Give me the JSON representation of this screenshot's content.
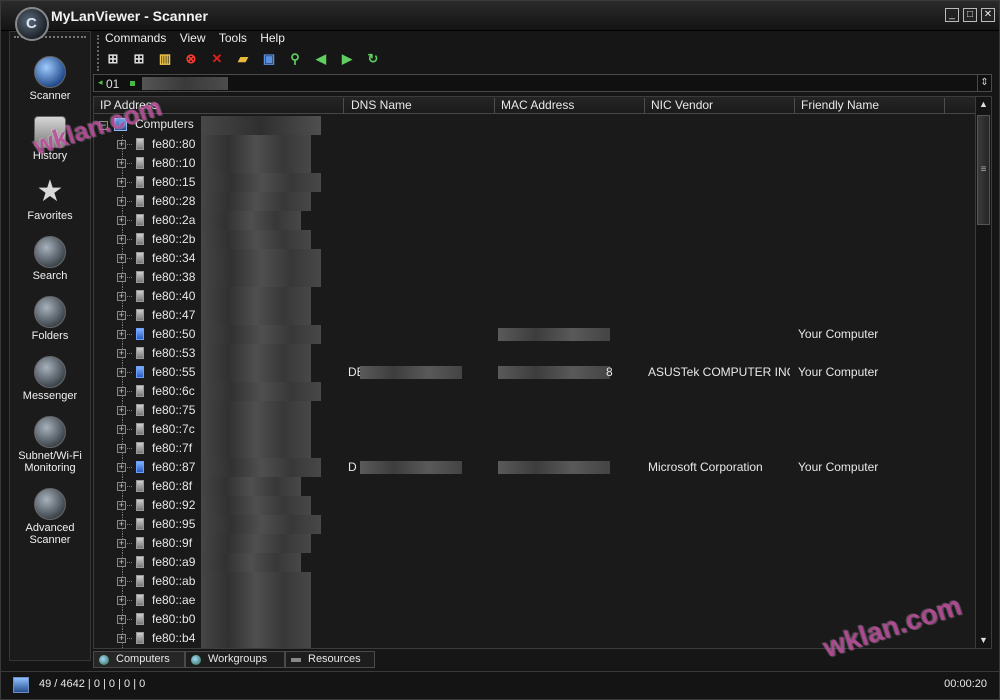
{
  "window": {
    "title": "MyLanViewer - Scanner",
    "logo_glyph": "C"
  },
  "menu": [
    "Commands",
    "View",
    "Tools",
    "Help"
  ],
  "sidebar": {
    "items": [
      {
        "label": "Scanner",
        "icon": "globe-icon"
      },
      {
        "label": "History",
        "icon": "history-icon"
      },
      {
        "label": "Favorites",
        "icon": "star-icon"
      },
      {
        "label": "Search",
        "icon": "search-icon"
      },
      {
        "label": "Folders",
        "icon": "folders-icon"
      },
      {
        "label": "Messenger",
        "icon": "messenger-icon"
      },
      {
        "label": "Subnet/Wi-Fi Monitoring",
        "icon": "monitoring-icon"
      },
      {
        "label": "Advanced Scanner",
        "icon": "advanced-scanner-icon"
      }
    ]
  },
  "address": {
    "value": "01"
  },
  "columns": [
    "IP Address",
    "DNS Name",
    "MAC Address",
    "NIC Vendor",
    "Friendly Name"
  ],
  "tree_root": {
    "label": "Computers"
  },
  "rows": [
    {
      "ip": "fe80::80",
      "dns": "",
      "mac": "",
      "vendor": "",
      "friendly": ""
    },
    {
      "ip": "fe80::10",
      "dns": "",
      "mac": "",
      "vendor": "",
      "friendly": ""
    },
    {
      "ip": "fe80::15",
      "dns": "",
      "mac": "",
      "vendor": "",
      "friendly": ""
    },
    {
      "ip": "fe80::28",
      "dns": "",
      "mac": "",
      "vendor": "",
      "friendly": ""
    },
    {
      "ip": "fe80::2a",
      "dns": "",
      "mac": "",
      "vendor": "",
      "friendly": ""
    },
    {
      "ip": "fe80::2b",
      "dns": "",
      "mac": "",
      "vendor": "",
      "friendly": ""
    },
    {
      "ip": "fe80::34",
      "dns": "",
      "mac": "",
      "vendor": "",
      "friendly": ""
    },
    {
      "ip": "fe80::38",
      "dns": "",
      "mac": "",
      "vendor": "",
      "friendly": ""
    },
    {
      "ip": "fe80::40",
      "dns": "",
      "mac": "",
      "vendor": "",
      "friendly": ""
    },
    {
      "ip": "fe80::47",
      "dns": "",
      "mac": "",
      "vendor": "",
      "friendly": ""
    },
    {
      "ip": "fe80::50",
      "dns": "",
      "mac": "",
      "vendor": "",
      "friendly": "Your Computer",
      "own": true,
      "mac_blur": true
    },
    {
      "ip": "fe80::53",
      "dns": "",
      "mac": "",
      "vendor": "",
      "friendly": ""
    },
    {
      "ip": "fe80::55",
      "dns": "DE",
      "mac": "8",
      "vendor": "ASUSTek COMPUTER INC",
      "friendly": "Your Computer",
      "own": true,
      "dns_blur": true,
      "mac_blur": true
    },
    {
      "ip": "fe80::6c",
      "dns": "",
      "mac": "",
      "vendor": "",
      "friendly": ""
    },
    {
      "ip": "fe80::75",
      "dns": "",
      "mac": "",
      "vendor": "",
      "friendly": ""
    },
    {
      "ip": "fe80::7c",
      "dns": "",
      "mac": "",
      "vendor": "",
      "friendly": ""
    },
    {
      "ip": "fe80::7f",
      "dns": "",
      "mac": "",
      "vendor": "",
      "friendly": ""
    },
    {
      "ip": "fe80::87",
      "dns": "D",
      "mac": "",
      "vendor": "Microsoft Corporation",
      "friendly": "Your Computer",
      "own": true,
      "dns_blur": true,
      "mac_blur": true
    },
    {
      "ip": "fe80::8f",
      "dns": "",
      "mac": "",
      "vendor": "",
      "friendly": ""
    },
    {
      "ip": "fe80::92",
      "dns": "",
      "mac": "",
      "vendor": "",
      "friendly": ""
    },
    {
      "ip": "fe80::95",
      "dns": "",
      "mac": "",
      "vendor": "",
      "friendly": ""
    },
    {
      "ip": "fe80::9f",
      "dns": "",
      "mac": "",
      "vendor": "",
      "friendly": ""
    },
    {
      "ip": "fe80::a9",
      "dns": "",
      "mac": "",
      "vendor": "",
      "friendly": ""
    },
    {
      "ip": "fe80::ab",
      "dns": "",
      "mac": "",
      "vendor": "",
      "friendly": ""
    },
    {
      "ip": "fe80::ae",
      "dns": "",
      "mac": "",
      "vendor": "",
      "friendly": ""
    },
    {
      "ip": "fe80::b0",
      "dns": "",
      "mac": "",
      "vendor": "",
      "friendly": ""
    },
    {
      "ip": "fe80::b4",
      "dns": "",
      "mac": "",
      "vendor": "",
      "friendly": ""
    }
  ],
  "tabs": [
    "Computers",
    "Workgroups",
    "Resources"
  ],
  "status": {
    "text": "49 / 4642  |  0  |  0  |  0  |  0",
    "time": "00:00:20"
  },
  "watermark": "wklan.com"
}
